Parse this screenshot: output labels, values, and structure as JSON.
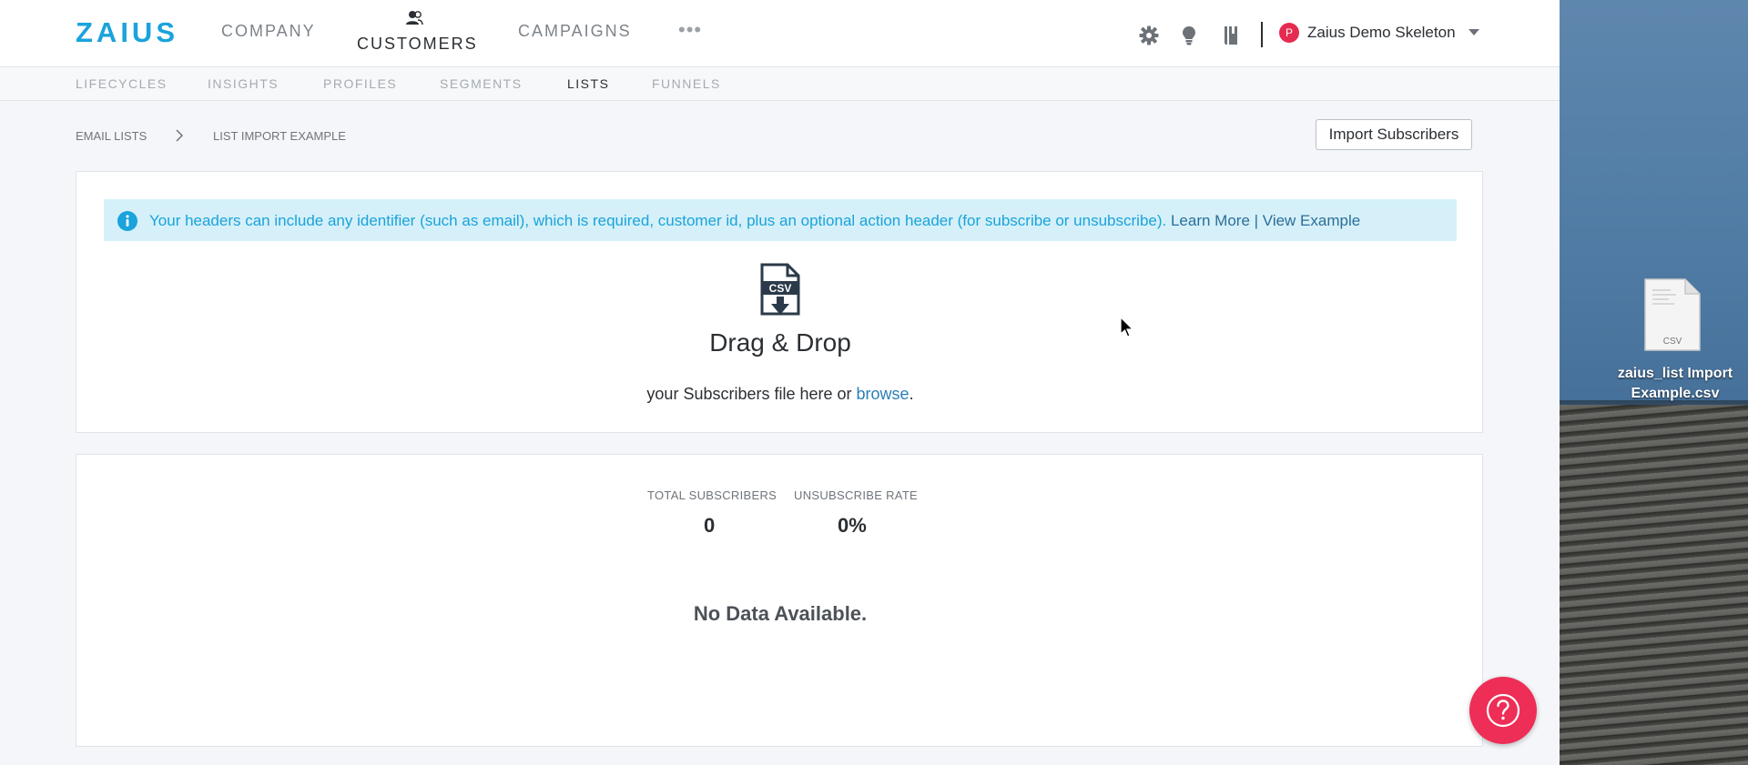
{
  "app": {
    "logo": "ZAIUS",
    "nav": [
      {
        "label": "COMPANY"
      },
      {
        "label": "CUSTOMERS"
      },
      {
        "label": "CAMPAIGNS"
      }
    ],
    "nav_more": "•••",
    "account": {
      "initial": "P",
      "name": "Zaius Demo Skeleton"
    }
  },
  "subnav": [
    "LIFECYCLES",
    "INSIGHTS",
    "PROFILES",
    "SEGMENTS",
    "LISTS",
    "FUNNELS"
  ],
  "breadcrumb": [
    "EMAIL LISTS",
    "LIST IMPORT EXAMPLE"
  ],
  "import_button": "Import Subscribers",
  "info": {
    "text": "Your headers can include any identifier (such as email), which is required, customer id, plus an optional action header (for subscribe or unsubscribe). ",
    "learn_more": "Learn More",
    "separator": " | ",
    "view_example": "View Example"
  },
  "upload": {
    "icon_label": "CSV",
    "title": "Drag & Drop",
    "subtitle_prefix": "your Subscribers file here or ",
    "browse": "browse",
    "subtitle_suffix": "."
  },
  "stats": {
    "total_label": "TOTAL SUBSCRIBERS",
    "total_value": "0",
    "unsub_label": "UNSUBSCRIBE RATE",
    "unsub_value": "0%",
    "no_data": "No Data Available."
  },
  "help_icon": "question-icon",
  "desktop": {
    "file_type": "CSV",
    "file_name_line1": "zaius_list Import",
    "file_name_line2": "Example.csv"
  },
  "colors": {
    "brand": "#1aa3dc",
    "help": "#ee2e56",
    "avatar": "#e52b50",
    "info_bg": "#d5f0f8"
  }
}
